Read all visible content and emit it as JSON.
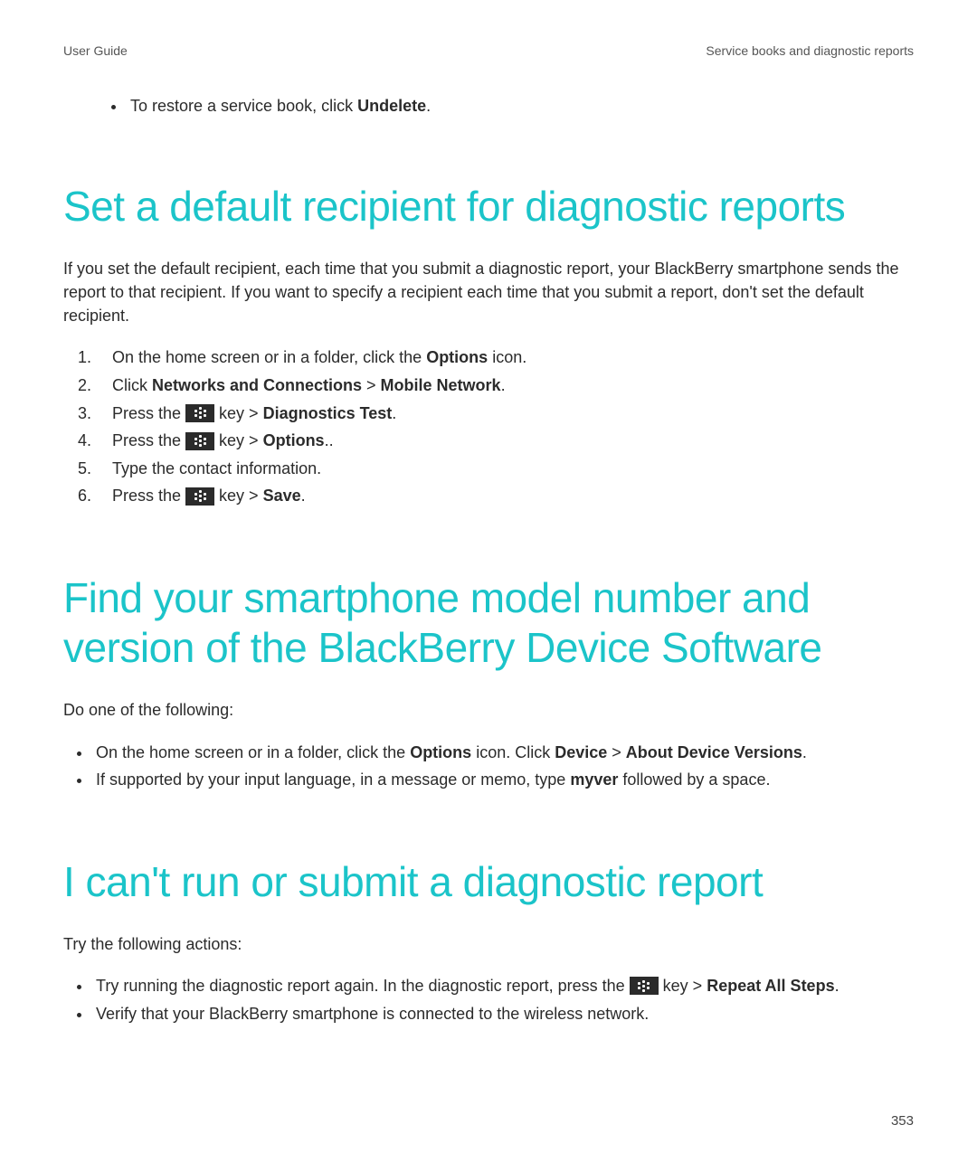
{
  "header": {
    "left": "User Guide",
    "right": "Service books and diagnostic reports"
  },
  "intro_bullet": {
    "text_a": "To restore a service book, click ",
    "bold": "Undelete",
    "text_b": "."
  },
  "section1": {
    "title": "Set a default recipient for diagnostic reports",
    "para": "If you set the default recipient, each time that you submit a diagnostic report, your BlackBerry smartphone sends the report to that recipient. If you want to specify a recipient each time that you submit a report, don't set the default recipient.",
    "steps": {
      "s1_a": "On the home screen or in a folder, click the ",
      "s1_bold": "Options",
      "s1_b": " icon.",
      "s2_a": "Click ",
      "s2_bold1": "Networks and Connections",
      "s2_mid": " > ",
      "s2_bold2": "Mobile Network",
      "s2_b": ".",
      "s3_a": "Press the ",
      "s3_key": " key > ",
      "s3_bold": "Diagnostics Test",
      "s3_b": ".",
      "s4_a": "Press the ",
      "s4_key": " key > ",
      "s4_bold": "Options",
      "s4_b": "..",
      "s5": "Type the contact information.",
      "s6_a": "Press the ",
      "s6_key": " key > ",
      "s6_bold": "Save",
      "s6_b": "."
    }
  },
  "section2": {
    "title": "Find your smartphone model number and version of the BlackBerry Device Software",
    "para": "Do one of the following:",
    "b1_a": "On the home screen or in a folder, click the ",
    "b1_bold1": "Options",
    "b1_mid1": " icon. Click ",
    "b1_bold2": "Device",
    "b1_mid2": " > ",
    "b1_bold3": "About Device Versions",
    "b1_b": ".",
    "b2_a": "If supported by your input language, in a message or memo, type ",
    "b2_bold": "myver",
    "b2_b": " followed by a space."
  },
  "section3": {
    "title": "I can't run or submit a diagnostic report",
    "para": "Try the following actions:",
    "b1_a": "Try running the diagnostic report again. In the diagnostic report, press the ",
    "b1_key": " key > ",
    "b1_bold": "Repeat All Steps",
    "b1_b": ".",
    "b2": "Verify that your BlackBerry smartphone is connected to the wireless network."
  },
  "page_number": "353"
}
